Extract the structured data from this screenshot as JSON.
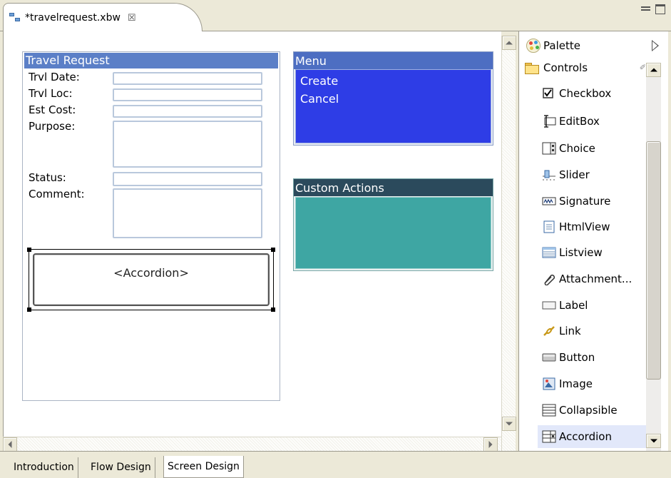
{
  "editor_tab": {
    "title": "*travelrequest.xbw",
    "close": "☒"
  },
  "form": {
    "header": "Travel Request",
    "labels": {
      "date": "Trvl Date:",
      "loc": "Trvl Loc:",
      "cost": "Est Cost:",
      "purpose": "Purpose:",
      "status": "Status:",
      "comment": "Comment:"
    },
    "accordion": "<Accordion>"
  },
  "menu": {
    "header": "Menu",
    "items": [
      "Create",
      "Cancel"
    ]
  },
  "custom_actions": {
    "header": "Custom Actions"
  },
  "palette": {
    "title": "Palette",
    "drawer": "Controls",
    "items": [
      "Checkbox",
      "EditBox",
      "Choice",
      "Slider",
      "Signature",
      "HtmlView",
      "Listview",
      "Attachment...",
      "Label",
      "Link",
      "Button",
      "Image",
      "Collapsible",
      "Accordion"
    ],
    "selected_item": "Accordion"
  },
  "page_tabs": [
    "Introduction",
    "Flow Design",
    "Screen Design"
  ],
  "active_page_tab": "Screen Design",
  "colors": {
    "form_header": "#5b7fc7",
    "menu_header": "#4d6ec2",
    "menu_body": "#2e3de6",
    "custom_header": "#2b4a5c",
    "custom_body": "#3ea6a3",
    "palette_selected": "#e2e8fa"
  }
}
